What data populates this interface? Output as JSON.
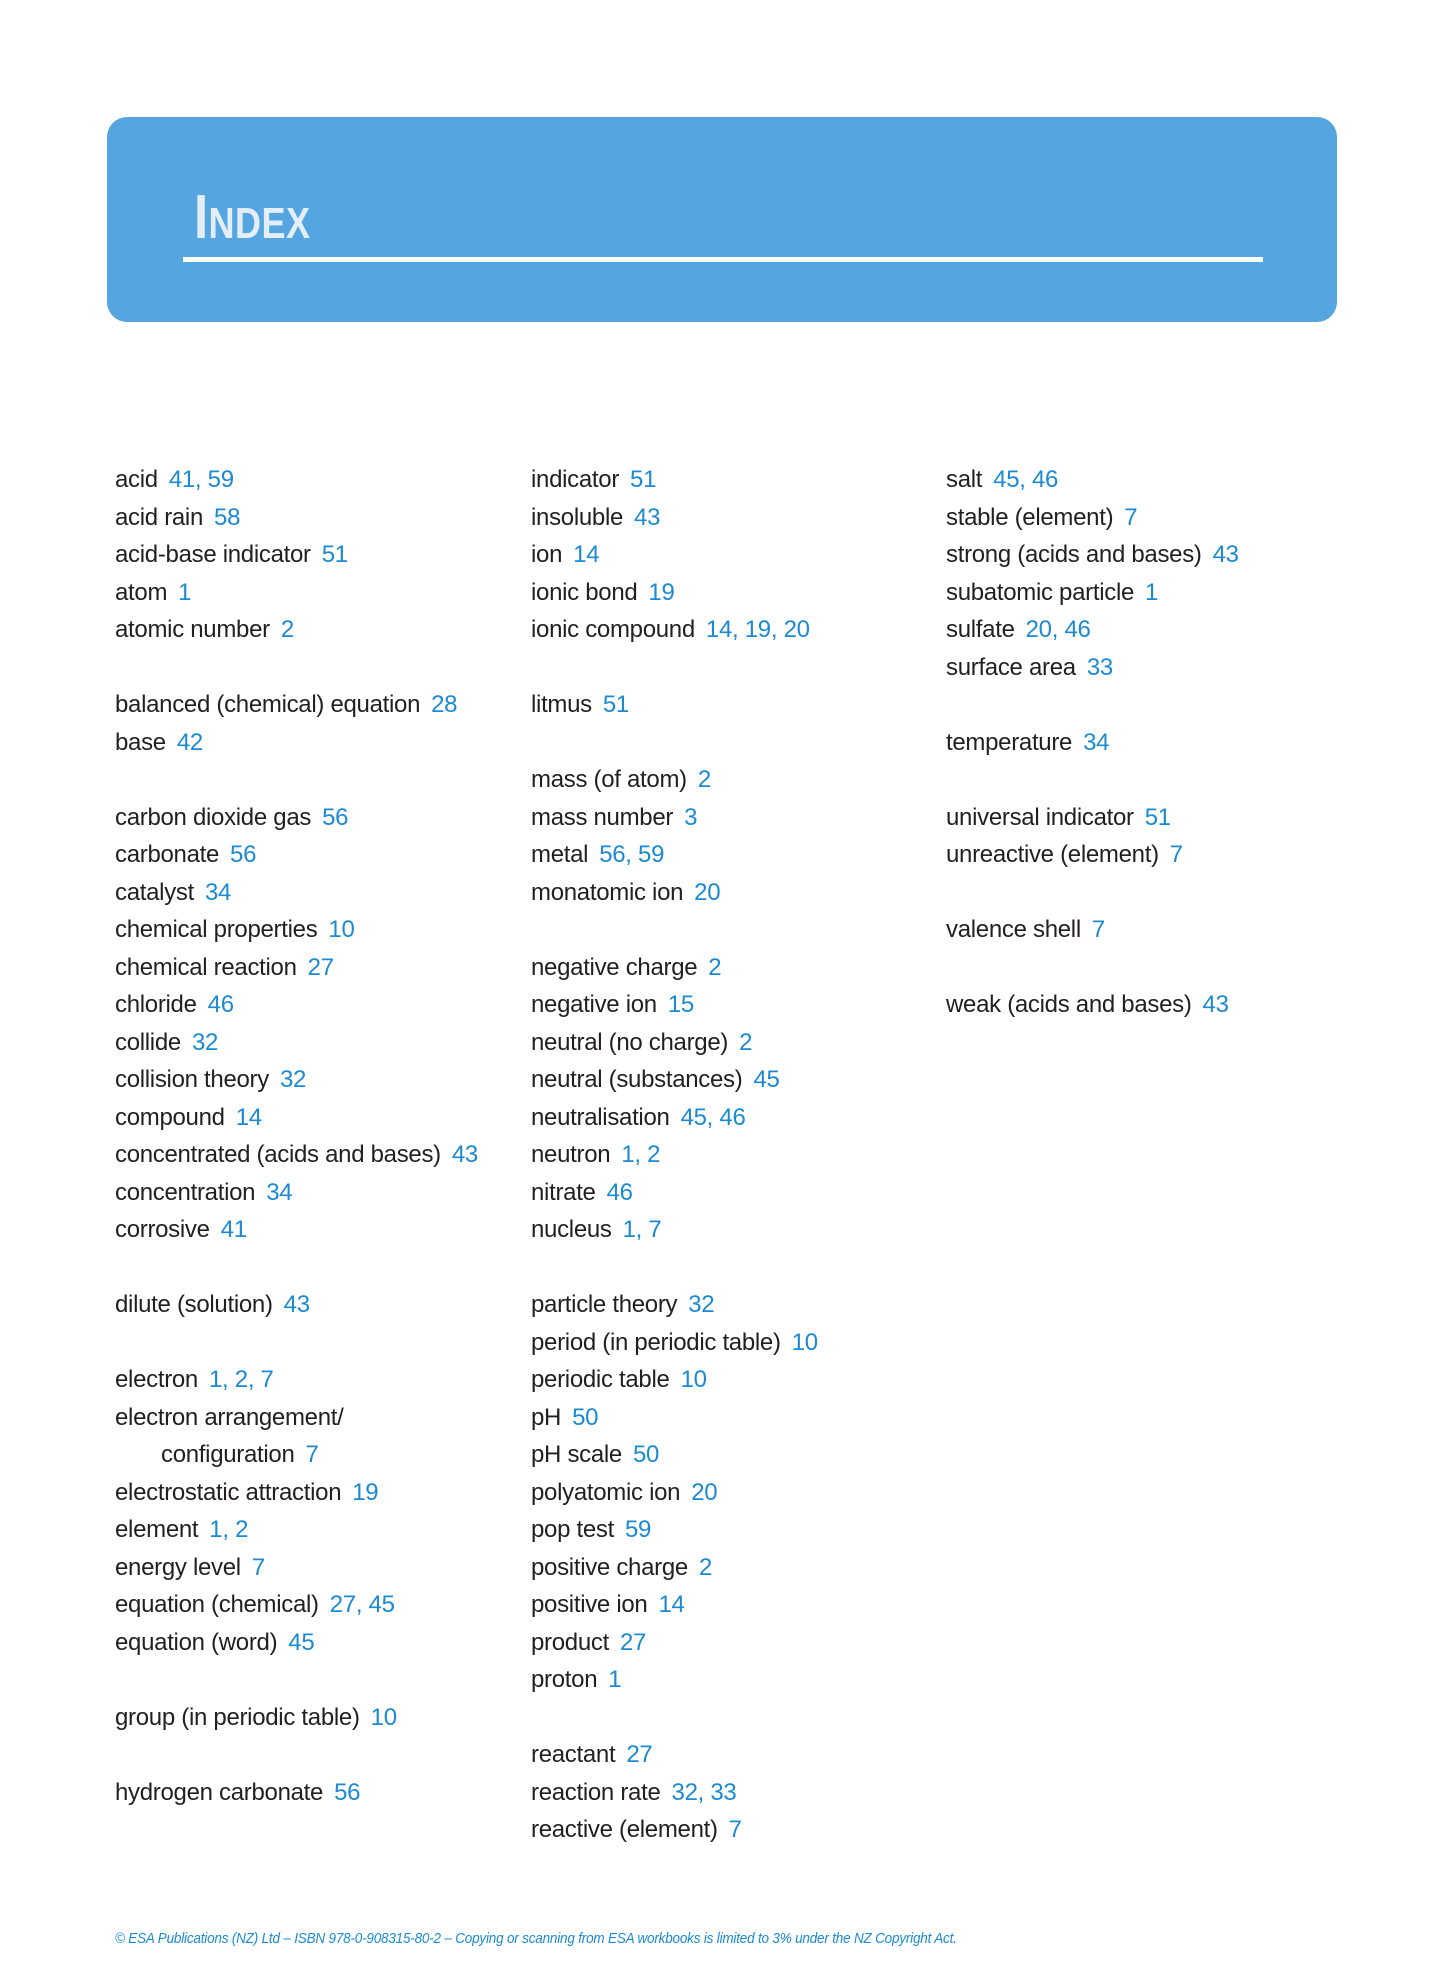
{
  "header": {
    "title_initial": "I",
    "title_rest": "ndex",
    "title": "Index"
  },
  "colors": {
    "banner": "#55a6e0",
    "title_text": "#e3eef9",
    "term_text": "#231f20",
    "page_numbers": "#1b8ad3"
  },
  "columns": [
    {
      "entries": [
        {
          "term": "acid",
          "pages": "41, 59"
        },
        {
          "term": "acid rain",
          "pages": "58"
        },
        {
          "term": "acid-base indicator",
          "pages": "51"
        },
        {
          "term": "atom",
          "pages": "1"
        },
        {
          "term": "atomic number",
          "pages": "2"
        },
        {
          "blank": true
        },
        {
          "term": "balanced (chemical) equation",
          "pages": "28"
        },
        {
          "term": "base",
          "pages": "42"
        },
        {
          "blank": true
        },
        {
          "term": "carbon dioxide gas",
          "pages": "56"
        },
        {
          "term": "carbonate",
          "pages": "56"
        },
        {
          "term": "catalyst",
          "pages": "34"
        },
        {
          "term": "chemical properties",
          "pages": "10"
        },
        {
          "term": "chemical reaction",
          "pages": "27"
        },
        {
          "term": "chloride",
          "pages": "46"
        },
        {
          "term": "collide",
          "pages": "32"
        },
        {
          "term": "collision theory",
          "pages": "32"
        },
        {
          "term": "compound",
          "pages": "14"
        },
        {
          "term": "concentrated (acids and bases)",
          "pages": "43"
        },
        {
          "term": "concentration",
          "pages": "34"
        },
        {
          "term": "corrosive",
          "pages": "41"
        },
        {
          "blank": true
        },
        {
          "term": "dilute (solution)",
          "pages": "43"
        },
        {
          "blank": true
        },
        {
          "term": "electron",
          "pages": "1, 2, 7"
        },
        {
          "term": "electron arrangement/",
          "pages": ""
        },
        {
          "term": "configuration",
          "pages": "7",
          "indent": true
        },
        {
          "term": "electrostatic attraction",
          "pages": "19"
        },
        {
          "term": "element",
          "pages": "1, 2"
        },
        {
          "term": "energy level",
          "pages": "7"
        },
        {
          "term": "equation (chemical)",
          "pages": "27, 45"
        },
        {
          "term": "equation (word)",
          "pages": "45"
        },
        {
          "blank": true
        },
        {
          "term": "group (in periodic table)",
          "pages": "10"
        },
        {
          "blank": true
        },
        {
          "term": "hydrogen carbonate",
          "pages": "56"
        }
      ]
    },
    {
      "entries": [
        {
          "term": "indicator",
          "pages": "51"
        },
        {
          "term": "insoluble",
          "pages": "43"
        },
        {
          "term": "ion",
          "pages": "14"
        },
        {
          "term": "ionic bond",
          "pages": "19"
        },
        {
          "term": "ionic compound",
          "pages": "14, 19, 20"
        },
        {
          "blank": true
        },
        {
          "term": "litmus",
          "pages": "51"
        },
        {
          "blank": true
        },
        {
          "term": "mass (of atom)",
          "pages": "2"
        },
        {
          "term": "mass number",
          "pages": "3"
        },
        {
          "term": "metal",
          "pages": "56, 59"
        },
        {
          "term": "monatomic ion",
          "pages": "20"
        },
        {
          "blank": true
        },
        {
          "term": "negative charge",
          "pages": "2"
        },
        {
          "term": "negative ion",
          "pages": "15"
        },
        {
          "term": "neutral (no charge)",
          "pages": "2"
        },
        {
          "term": "neutral (substances)",
          "pages": "45"
        },
        {
          "term": "neutralisation",
          "pages": "45, 46"
        },
        {
          "term": "neutron",
          "pages": "1, 2"
        },
        {
          "term": "nitrate",
          "pages": "46"
        },
        {
          "term": "nucleus",
          "pages": "1, 7"
        },
        {
          "blank": true
        },
        {
          "term": "particle theory",
          "pages": "32"
        },
        {
          "term": "period (in periodic table)",
          "pages": "10"
        },
        {
          "term": "periodic table",
          "pages": "10"
        },
        {
          "term": "pH",
          "pages": "50"
        },
        {
          "term": "pH scale",
          "pages": "50"
        },
        {
          "term": "polyatomic ion",
          "pages": "20"
        },
        {
          "term": "pop test",
          "pages": "59"
        },
        {
          "term": "positive charge",
          "pages": "2"
        },
        {
          "term": "positive ion",
          "pages": "14"
        },
        {
          "term": "product",
          "pages": "27"
        },
        {
          "term": "proton",
          "pages": "1"
        },
        {
          "blank": true
        },
        {
          "term": "reactant",
          "pages": "27"
        },
        {
          "term": "reaction rate",
          "pages": "32, 33"
        },
        {
          "term": "reactive (element)",
          "pages": "7"
        }
      ]
    },
    {
      "entries": [
        {
          "term": "salt",
          "pages": "45, 46"
        },
        {
          "term": "stable (element)",
          "pages": "7"
        },
        {
          "term": "strong (acids and bases)",
          "pages": "43"
        },
        {
          "term": "subatomic particle",
          "pages": "1"
        },
        {
          "term": "sulfate",
          "pages": "20, 46"
        },
        {
          "term": "surface area",
          "pages": "33"
        },
        {
          "blank": true
        },
        {
          "term": "temperature",
          "pages": "34"
        },
        {
          "blank": true
        },
        {
          "term": "universal indicator",
          "pages": "51"
        },
        {
          "term": "unreactive (element)",
          "pages": "7"
        },
        {
          "blank": true
        },
        {
          "term": "valence shell",
          "pages": "7"
        },
        {
          "blank": true
        },
        {
          "term": "weak (acids and bases)",
          "pages": "43"
        }
      ]
    }
  ],
  "footer": {
    "text": "© ESA Publications (NZ) Ltd  –  ISBN 978-0-908315-80-2 –  Copying or scanning from ESA workbooks is limited to 3% under the NZ Copyright Act."
  }
}
